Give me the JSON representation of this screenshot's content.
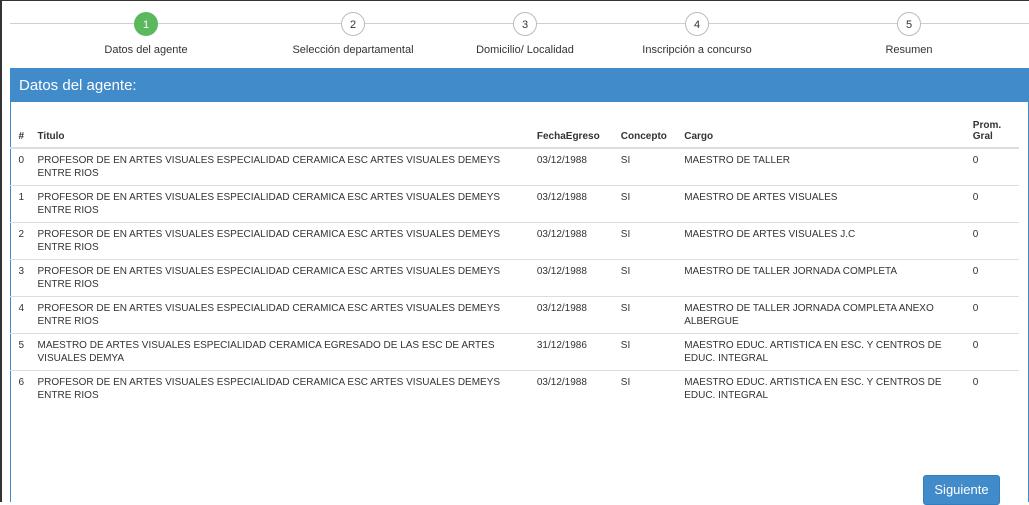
{
  "stepper": [
    {
      "num": "1",
      "label": "Datos del agente",
      "active": true
    },
    {
      "num": "2",
      "label": "Selección departamental",
      "active": false
    },
    {
      "num": "3",
      "label": "Domicilio/ Localidad",
      "active": false
    },
    {
      "num": "4",
      "label": "Inscripción a concurso",
      "active": false
    },
    {
      "num": "5",
      "label": "Resumen",
      "active": false
    }
  ],
  "panel": {
    "title": "Datos del agente:"
  },
  "table": {
    "headers": {
      "num": "#",
      "titulo": "Titulo",
      "fecha": "FechaEgreso",
      "concepto": "Concepto",
      "cargo": "Cargo",
      "prom": "Prom. Gral"
    },
    "rows": [
      {
        "num": "0",
        "titulo": "PROFESOR DE EN ARTES VISUALES ESPECIALIDAD CERAMICA ESC ARTES VISUALES DEMEYS ENTRE RIOS",
        "fecha": "03/12/1988",
        "concepto": "SI",
        "cargo": "MAESTRO DE TALLER",
        "prom": "0"
      },
      {
        "num": "1",
        "titulo": "PROFESOR DE EN ARTES VISUALES ESPECIALIDAD CERAMICA ESC ARTES VISUALES DEMEYS ENTRE RIOS",
        "fecha": "03/12/1988",
        "concepto": "SI",
        "cargo": "MAESTRO DE ARTES VISUALES",
        "prom": "0"
      },
      {
        "num": "2",
        "titulo": "PROFESOR DE EN ARTES VISUALES ESPECIALIDAD CERAMICA ESC ARTES VISUALES DEMEYS ENTRE RIOS",
        "fecha": "03/12/1988",
        "concepto": "SI",
        "cargo": "MAESTRO DE ARTES VISUALES J.C",
        "prom": "0"
      },
      {
        "num": "3",
        "titulo": "PROFESOR DE EN ARTES VISUALES ESPECIALIDAD CERAMICA ESC ARTES VISUALES DEMEYS ENTRE RIOS",
        "fecha": "03/12/1988",
        "concepto": "SI",
        "cargo": "MAESTRO DE TALLER JORNADA COMPLETA",
        "prom": "0"
      },
      {
        "num": "4",
        "titulo": "PROFESOR DE EN ARTES VISUALES ESPECIALIDAD CERAMICA ESC ARTES VISUALES DEMEYS ENTRE RIOS",
        "fecha": "03/12/1988",
        "concepto": "SI",
        "cargo": "MAESTRO DE TALLER JORNADA COMPLETA ANEXO ALBERGUE",
        "prom": "0"
      },
      {
        "num": "5",
        "titulo": "MAESTRO DE ARTES VISUALES ESPECIALIDAD CERAMICA EGRESADO DE LAS ESC DE ARTES VISUALES DEMYA",
        "fecha": "31/12/1986",
        "concepto": "SI",
        "cargo": "MAESTRO EDUC. ARTISTICA EN ESC. Y CENTROS DE EDUC. INTEGRAL",
        "prom": "0"
      },
      {
        "num": "6",
        "titulo": "PROFESOR DE EN ARTES VISUALES ESPECIALIDAD CERAMICA ESC ARTES VISUALES DEMEYS ENTRE RIOS",
        "fecha": "03/12/1988",
        "concepto": "SI",
        "cargo": "MAESTRO EDUC. ARTISTICA EN ESC. Y CENTROS DE EDUC. INTEGRAL",
        "prom": "0"
      }
    ]
  },
  "buttons": {
    "next": "Siguiente"
  },
  "colors": {
    "primary": "#428bca",
    "active_step": "#5cb85c"
  }
}
